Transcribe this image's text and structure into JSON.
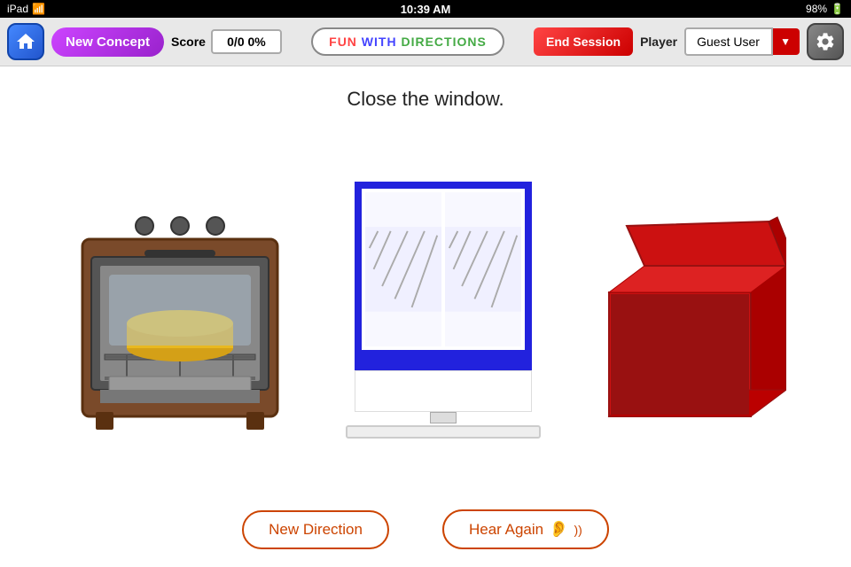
{
  "status_bar": {
    "left_label": "iPad",
    "wifi_icon": "wifi",
    "time": "10:39 AM",
    "battery_icon": "battery",
    "battery_text": "98%"
  },
  "toolbar": {
    "home_icon": "home",
    "new_concept_label": "New Concept",
    "score_label": "Score",
    "score_value": "0/0  0%",
    "app_title_fun": "FUN",
    "app_title_with": " WITH ",
    "app_title_directions": "DIRECTIONS",
    "end_session_label": "End Session",
    "player_label": "Player",
    "guest_user_label": "Guest User",
    "settings_icon": "settings"
  },
  "main": {
    "instruction": "Close the window."
  },
  "bottom_buttons": {
    "new_direction_label": "New Direction",
    "hear_again_label": "Hear Again"
  }
}
